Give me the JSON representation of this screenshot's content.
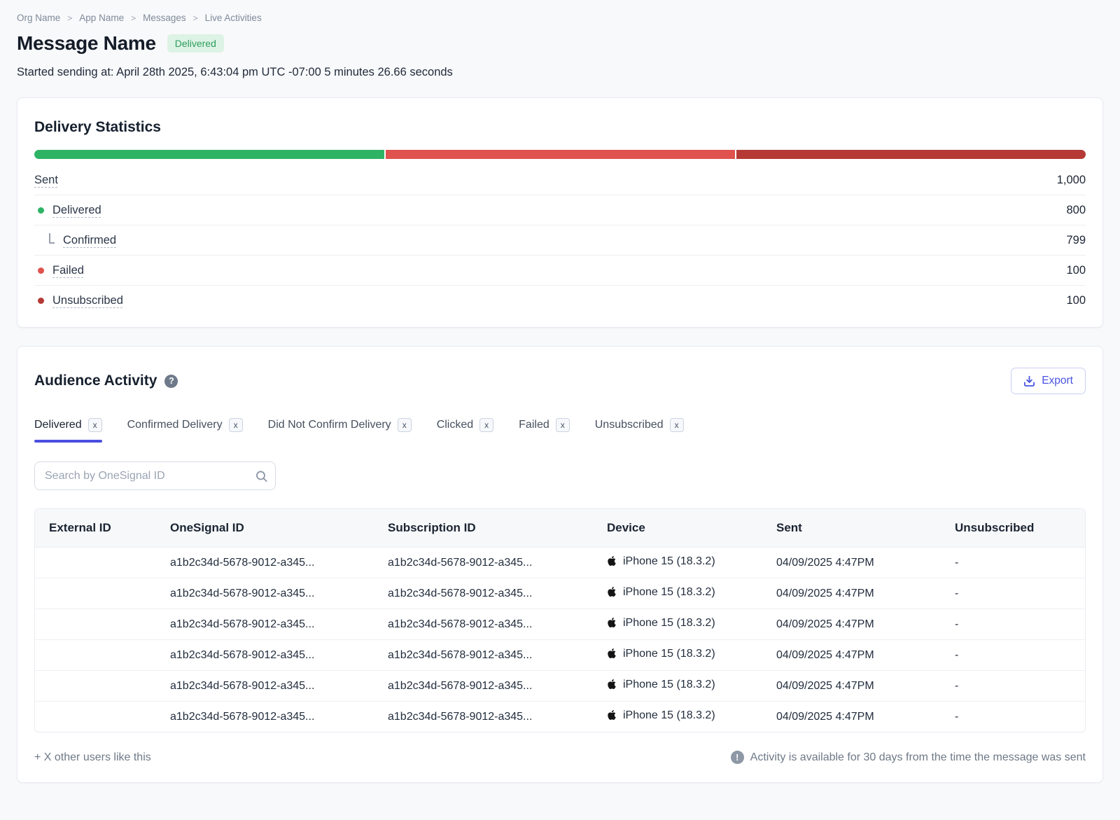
{
  "breadcrumb": {
    "separator": ">",
    "items": [
      "Org Name",
      "App Name",
      "Messages",
      "Live Activities"
    ]
  },
  "header": {
    "title": "Message Name",
    "status_badge": "Delivered",
    "subtitle": "Started sending at: April 28th 2025, 6:43:04 pm UTC -07:00 5 minutes 26.66 seconds"
  },
  "colors": {
    "accent": "#4a4fe0",
    "green": "#2eb364",
    "red": "#e0524e",
    "dark_red": "#b53a36",
    "badge_bg": "#ddf3e5",
    "badge_text": "#2f9e5e"
  },
  "icons": {
    "help_glyph": "?",
    "info_glyph": "!"
  },
  "delivery_statistics": {
    "title": "Delivery Statistics",
    "bar_segments": [
      {
        "name": "delivered",
        "color": "#2eb364",
        "percent": 33.4
      },
      {
        "name": "failed",
        "color": "#e0524e",
        "percent": 33.3
      },
      {
        "name": "unsubscribed",
        "color": "#b53a36",
        "percent": 33.3
      }
    ],
    "rows": [
      {
        "label": "Sent",
        "value": "1,000",
        "dot": "",
        "indent": false
      },
      {
        "label": "Delivered",
        "value": "800",
        "dot": "#2eb364",
        "indent": false
      },
      {
        "label": "Confirmed",
        "value": "799",
        "dot": "",
        "indent": true
      },
      {
        "label": "Failed",
        "value": "100",
        "dot": "#e0524e",
        "indent": false
      },
      {
        "label": "Unsubscribed",
        "value": "100",
        "dot": "#b53a36",
        "indent": false
      }
    ]
  },
  "audience_activity": {
    "title": "Audience Activity",
    "export_label": "Export",
    "tabs": [
      {
        "label": "Delivered",
        "badge": "x",
        "active": true
      },
      {
        "label": "Confirmed Delivery",
        "badge": "x",
        "active": false
      },
      {
        "label": "Did Not Confirm Delivery",
        "badge": "x",
        "active": false
      },
      {
        "label": "Clicked",
        "badge": "x",
        "active": false
      },
      {
        "label": "Failed",
        "badge": "x",
        "active": false
      },
      {
        "label": "Unsubscribed",
        "badge": "x",
        "active": false
      }
    ],
    "search_placeholder": "Search by OneSignal ID",
    "table": {
      "columns": [
        "External ID",
        "OneSignal ID",
        "Subscription ID",
        "Device",
        "Sent",
        "Unsubscribed"
      ],
      "rows": [
        {
          "external_id": "",
          "onesignal_id": "a1b2c34d-5678-9012-a345...",
          "subscription_id": "a1b2c34d-5678-9012-a345...",
          "device": "iPhone 15 (18.3.2)",
          "sent": "04/09/2025 4:47PM",
          "unsubscribed": "-"
        },
        {
          "external_id": "",
          "onesignal_id": "a1b2c34d-5678-9012-a345...",
          "subscription_id": "a1b2c34d-5678-9012-a345...",
          "device": "iPhone 15 (18.3.2)",
          "sent": "04/09/2025 4:47PM",
          "unsubscribed": "-"
        },
        {
          "external_id": "",
          "onesignal_id": "a1b2c34d-5678-9012-a345...",
          "subscription_id": "a1b2c34d-5678-9012-a345...",
          "device": "iPhone 15 (18.3.2)",
          "sent": "04/09/2025 4:47PM",
          "unsubscribed": "-"
        },
        {
          "external_id": "",
          "onesignal_id": "a1b2c34d-5678-9012-a345...",
          "subscription_id": "a1b2c34d-5678-9012-a345...",
          "device": "iPhone 15 (18.3.2)",
          "sent": "04/09/2025 4:47PM",
          "unsubscribed": "-"
        },
        {
          "external_id": "",
          "onesignal_id": "a1b2c34d-5678-9012-a345...",
          "subscription_id": "a1b2c34d-5678-9012-a345...",
          "device": "iPhone 15 (18.3.2)",
          "sent": "04/09/2025 4:47PM",
          "unsubscribed": "-"
        },
        {
          "external_id": "",
          "onesignal_id": "a1b2c34d-5678-9012-a345...",
          "subscription_id": "a1b2c34d-5678-9012-a345...",
          "device": "iPhone 15 (18.3.2)",
          "sent": "04/09/2025 4:47PM",
          "unsubscribed": "-"
        }
      ]
    },
    "footer_left": "+ X other users like this",
    "footer_right": "Activity is available for 30 days from the time the message was sent"
  }
}
